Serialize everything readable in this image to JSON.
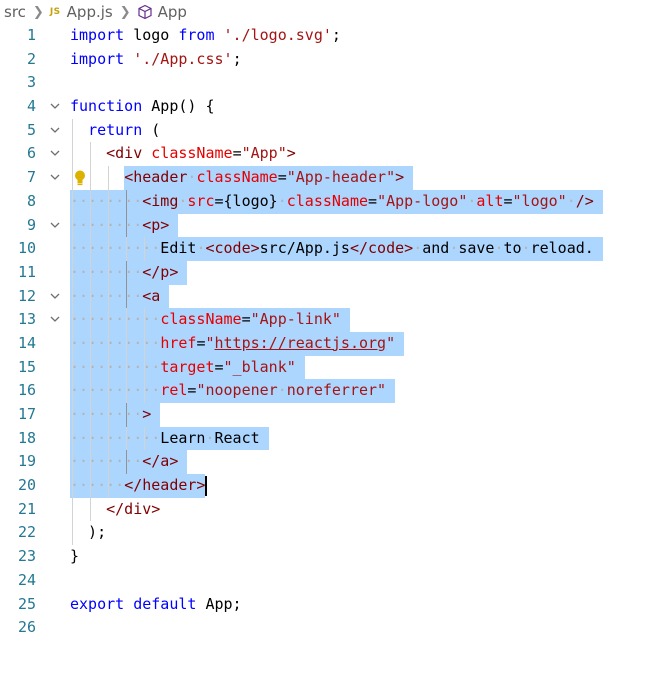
{
  "breadcrumb": {
    "folder": "src",
    "file_icon": "JS",
    "file": "App.js",
    "symbol_icon": "cube-icon",
    "symbol": "App"
  },
  "editor": {
    "colors": {
      "keyword": "#0000ff",
      "string": "#a31515",
      "tag": "#800000",
      "attribute": "#e50000",
      "line_number": "#237893",
      "selection": "#add6ff"
    },
    "selection_range": [
      7,
      20
    ],
    "cursor_line": 20,
    "lines": [
      {
        "n": "1",
        "tokens": [
          {
            "t": "import",
            "c": "kw"
          },
          {
            "t": " logo ",
            "c": "plain"
          },
          {
            "t": "from",
            "c": "kw"
          },
          {
            "t": " ",
            "c": "plain"
          },
          {
            "t": "'./logo.svg'",
            "c": "str"
          },
          {
            "t": ";",
            "c": "plain"
          }
        ]
      },
      {
        "n": "2",
        "tokens": [
          {
            "t": "import",
            "c": "kw"
          },
          {
            "t": " ",
            "c": "plain"
          },
          {
            "t": "'./App.css'",
            "c": "str"
          },
          {
            "t": ";",
            "c": "plain"
          }
        ]
      },
      {
        "n": "3",
        "tokens": []
      },
      {
        "n": "4",
        "fold": true,
        "tokens": [
          {
            "t": "function",
            "c": "kw"
          },
          {
            "t": " App() {",
            "c": "plain"
          }
        ]
      },
      {
        "n": "5",
        "fold": true,
        "tokens": [
          {
            "t": "  ",
            "c": "plain"
          },
          {
            "t": "return",
            "c": "kw"
          },
          {
            "t": " (",
            "c": "plain"
          }
        ]
      },
      {
        "n": "6",
        "fold": true,
        "tokens": [
          {
            "t": "    ",
            "c": "plain"
          },
          {
            "t": "<div",
            "c": "tag"
          },
          {
            "t": " ",
            "c": "plain"
          },
          {
            "t": "className",
            "c": "attr"
          },
          {
            "t": "=",
            "c": "plain"
          },
          {
            "t": "\"App\"",
            "c": "str"
          },
          {
            "t": ">",
            "c": "tag"
          }
        ]
      },
      {
        "n": "7",
        "fold": true,
        "bulb": true,
        "tokens": [
          {
            "t": "      ",
            "c": "plain"
          },
          {
            "t": "<header",
            "c": "tag"
          },
          {
            "t": " ",
            "c": "plain"
          },
          {
            "t": "className",
            "c": "attr"
          },
          {
            "t": "=",
            "c": "plain"
          },
          {
            "t": "\"App-header\"",
            "c": "str"
          },
          {
            "t": ">",
            "c": "tag"
          }
        ]
      },
      {
        "n": "8",
        "tokens": [
          {
            "t": "        ",
            "c": "plain"
          },
          {
            "t": "<img",
            "c": "tag"
          },
          {
            "t": " ",
            "c": "plain"
          },
          {
            "t": "src",
            "c": "attr"
          },
          {
            "t": "=",
            "c": "plain"
          },
          {
            "t": "{logo}",
            "c": "plain"
          },
          {
            "t": " ",
            "c": "plain"
          },
          {
            "t": "className",
            "c": "attr"
          },
          {
            "t": "=",
            "c": "plain"
          },
          {
            "t": "\"App-logo\"",
            "c": "str"
          },
          {
            "t": " ",
            "c": "plain"
          },
          {
            "t": "alt",
            "c": "attr"
          },
          {
            "t": "=",
            "c": "plain"
          },
          {
            "t": "\"logo\"",
            "c": "str"
          },
          {
            "t": " ",
            "c": "plain"
          },
          {
            "t": "/>",
            "c": "tag"
          }
        ]
      },
      {
        "n": "9",
        "fold": true,
        "tokens": [
          {
            "t": "        ",
            "c": "plain"
          },
          {
            "t": "<p>",
            "c": "tag"
          }
        ]
      },
      {
        "n": "10",
        "tokens": [
          {
            "t": "          Edit ",
            "c": "plain"
          },
          {
            "t": "<code>",
            "c": "tag"
          },
          {
            "t": "src/App.js",
            "c": "plain"
          },
          {
            "t": "</code>",
            "c": "tag"
          },
          {
            "t": " and save to reload.",
            "c": "plain"
          }
        ]
      },
      {
        "n": "11",
        "tokens": [
          {
            "t": "        ",
            "c": "plain"
          },
          {
            "t": "</p>",
            "c": "tag"
          }
        ]
      },
      {
        "n": "12",
        "fold": true,
        "tokens": [
          {
            "t": "        ",
            "c": "plain"
          },
          {
            "t": "<a",
            "c": "tag"
          }
        ]
      },
      {
        "n": "13",
        "fold": true,
        "tokens": [
          {
            "t": "          ",
            "c": "plain"
          },
          {
            "t": "className",
            "c": "attr"
          },
          {
            "t": "=",
            "c": "plain"
          },
          {
            "t": "\"App-link\"",
            "c": "str"
          }
        ]
      },
      {
        "n": "14",
        "tokens": [
          {
            "t": "          ",
            "c": "plain"
          },
          {
            "t": "href",
            "c": "attr"
          },
          {
            "t": "=",
            "c": "plain"
          },
          {
            "t": "\"",
            "c": "str"
          },
          {
            "t": "https://reactjs.org",
            "c": "str link"
          },
          {
            "t": "\"",
            "c": "str"
          }
        ]
      },
      {
        "n": "15",
        "tokens": [
          {
            "t": "          ",
            "c": "plain"
          },
          {
            "t": "target",
            "c": "attr"
          },
          {
            "t": "=",
            "c": "plain"
          },
          {
            "t": "\"_blank\"",
            "c": "str"
          }
        ]
      },
      {
        "n": "16",
        "tokens": [
          {
            "t": "          ",
            "c": "plain"
          },
          {
            "t": "rel",
            "c": "attr"
          },
          {
            "t": "=",
            "c": "plain"
          },
          {
            "t": "\"noopener noreferrer\"",
            "c": "str"
          }
        ]
      },
      {
        "n": "17",
        "tokens": [
          {
            "t": "        ",
            "c": "plain"
          },
          {
            "t": ">",
            "c": "tag"
          }
        ]
      },
      {
        "n": "18",
        "tokens": [
          {
            "t": "          Learn React",
            "c": "plain"
          }
        ]
      },
      {
        "n": "19",
        "tokens": [
          {
            "t": "        ",
            "c": "plain"
          },
          {
            "t": "</a>",
            "c": "tag"
          }
        ]
      },
      {
        "n": "20",
        "tokens": [
          {
            "t": "      ",
            "c": "plain"
          },
          {
            "t": "</header>",
            "c": "tag"
          }
        ]
      },
      {
        "n": "21",
        "tokens": [
          {
            "t": "    ",
            "c": "plain"
          },
          {
            "t": "</div>",
            "c": "tag"
          }
        ]
      },
      {
        "n": "22",
        "tokens": [
          {
            "t": "  );",
            "c": "plain"
          }
        ]
      },
      {
        "n": "23",
        "tokens": [
          {
            "t": "}",
            "c": "plain"
          }
        ]
      },
      {
        "n": "24",
        "tokens": []
      },
      {
        "n": "25",
        "tokens": [
          {
            "t": "export",
            "c": "kw"
          },
          {
            "t": " ",
            "c": "plain"
          },
          {
            "t": "default",
            "c": "kw"
          },
          {
            "t": " App;",
            "c": "plain"
          }
        ]
      },
      {
        "n": "26",
        "tokens": []
      }
    ]
  }
}
